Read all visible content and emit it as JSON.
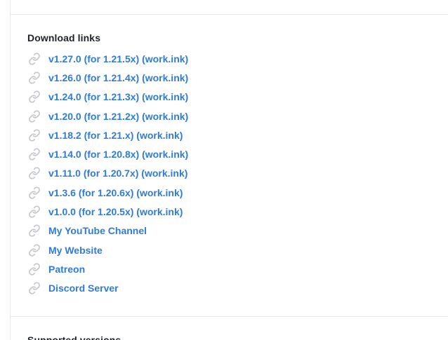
{
  "sections": {
    "download_title": "Download links",
    "supported_title": "Supported versions"
  },
  "links": [
    {
      "label": "v1.27.0 (for 1.21.5x) (work.ink)"
    },
    {
      "label": "v1.26.0 (for 1.21.4x) (work.ink)"
    },
    {
      "label": "v1.24.0 (for 1.21.3x) (work.ink)"
    },
    {
      "label": "v1.20.0 (for 1.21.2x) (work.ink)"
    },
    {
      "label": "v1.18.2 (for 1.21.x) (work.ink)"
    },
    {
      "label": "v1.14.0 (for 1.20.8x) (work.ink)"
    },
    {
      "label": "v1.11.0 (for 1.20.7x) (work.ink)"
    },
    {
      "label": "v1.3.6 (for 1.20.6x) (work.ink)"
    },
    {
      "label": "v1.0.0 (for 1.20.5x) (work.ink)"
    },
    {
      "label": "My YouTube Channel"
    },
    {
      "label": "My Website"
    },
    {
      "label": "Patreon"
    },
    {
      "label": "Discord Server"
    }
  ],
  "icons": {
    "link": "link-icon"
  },
  "colors": {
    "link_text": "#2f7bd8",
    "link_icon": "#c3c7cd",
    "heading": "#1f2328",
    "divider": "#e6e8ec"
  }
}
